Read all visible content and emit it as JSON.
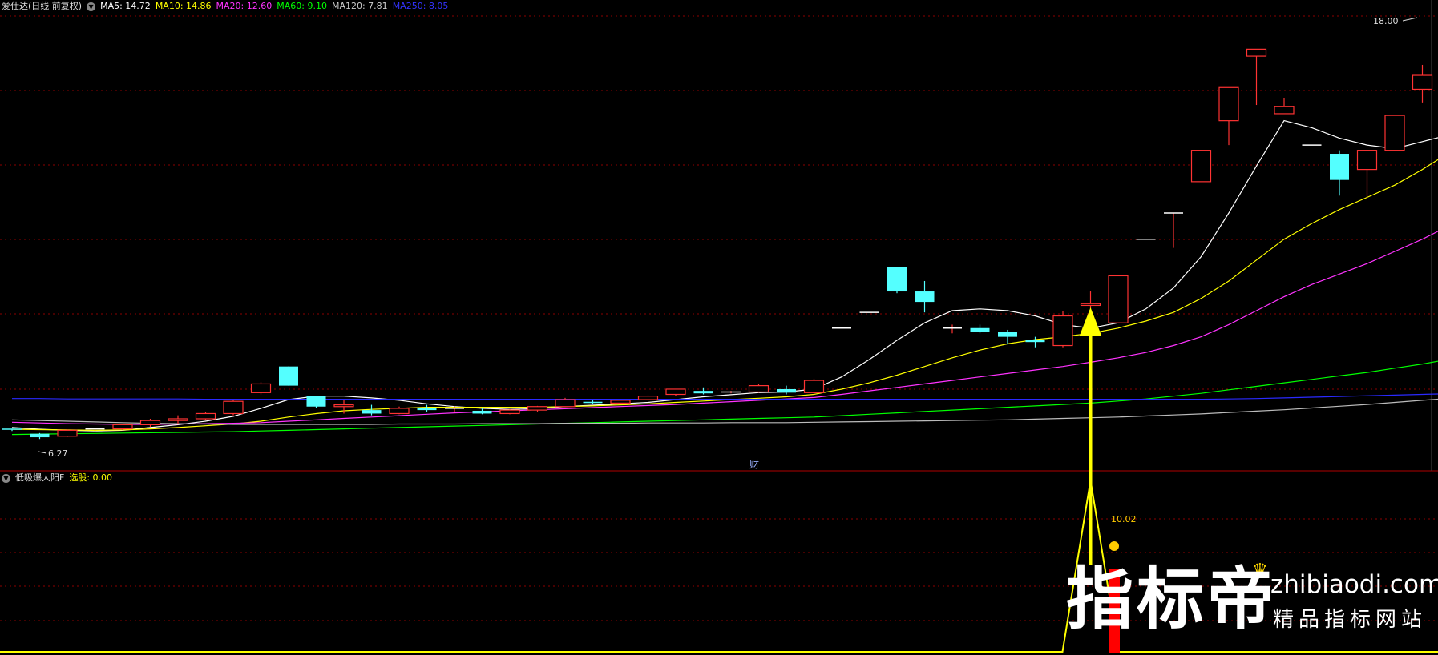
{
  "main_header": {
    "title": "爱仕达(日线 前复权)",
    "ma": [
      {
        "label": "MA5: 14.72",
        "color": "#ffffff"
      },
      {
        "label": "MA10: 14.86",
        "color": "#ffff00"
      },
      {
        "label": "MA20: 12.60",
        "color": "#ff33ff"
      },
      {
        "label": "MA60: 9.10",
        "color": "#00ff00"
      },
      {
        "label": "MA120: 7.81",
        "color": "#cccccc"
      },
      {
        "label": "MA250: 8.05",
        "color": "#2222ff"
      }
    ]
  },
  "sub_header": {
    "title": "低吸爆大阳F",
    "value_label": "选股: 0.00"
  },
  "annotations": {
    "high_label": "18.00",
    "low_label": "6.27",
    "cai_label": "财",
    "signal_value": "10.02",
    "signal_icon": "smiley-icon"
  },
  "watermark": {
    "cn": "指标帝",
    "url": "zhibiaodi.com",
    "sub": "精品指标网站"
  },
  "colors": {
    "up": "#ff3333",
    "down": "#54ffff",
    "grid": "#8b0000",
    "arrow": "#ffff00",
    "signal_bar": "#ff0000"
  },
  "chart_data": {
    "type": "candlestick",
    "ylim": [
      6.0,
      18.4
    ],
    "ohlc": [
      [
        6.55,
        6.55,
        6.5,
        6.52
      ],
      [
        6.42,
        6.44,
        6.27,
        6.32
      ],
      [
        6.35,
        6.55,
        6.33,
        6.52
      ],
      [
        6.52,
        6.58,
        6.48,
        6.56
      ],
      [
        6.56,
        6.7,
        6.52,
        6.68
      ],
      [
        6.68,
        6.85,
        6.62,
        6.8
      ],
      [
        6.8,
        6.95,
        6.7,
        6.85
      ],
      [
        6.85,
        7.05,
        6.8,
        7.0
      ],
      [
        7.0,
        7.4,
        6.95,
        7.35
      ],
      [
        7.6,
        7.9,
        7.55,
        7.85
      ],
      [
        8.35,
        8.35,
        7.8,
        7.8
      ],
      [
        7.5,
        7.5,
        7.15,
        7.2
      ],
      [
        7.2,
        7.4,
        7.0,
        7.25
      ],
      [
        7.1,
        7.25,
        6.95,
        7.0
      ],
      [
        7.0,
        7.2,
        6.98,
        7.15
      ],
      [
        7.15,
        7.25,
        7.05,
        7.1
      ],
      [
        7.12,
        7.2,
        7.05,
        7.15
      ],
      [
        7.08,
        7.15,
        6.98,
        7.0
      ],
      [
        7.0,
        7.12,
        6.98,
        7.1
      ],
      [
        7.1,
        7.22,
        7.05,
        7.2
      ],
      [
        7.2,
        7.45,
        7.18,
        7.4
      ],
      [
        7.32,
        7.38,
        7.28,
        7.3
      ],
      [
        7.3,
        7.4,
        7.28,
        7.38
      ],
      [
        7.4,
        7.52,
        7.38,
        7.5
      ],
      [
        7.55,
        7.7,
        7.5,
        7.7
      ],
      [
        7.65,
        7.75,
        7.55,
        7.58
      ],
      [
        7.6,
        7.65,
        7.58,
        7.62
      ],
      [
        7.62,
        7.85,
        7.6,
        7.8
      ],
      [
        7.7,
        7.8,
        7.55,
        7.6
      ],
      [
        7.6,
        8.0,
        7.55,
        7.95
      ],
      [
        9.45,
        9.45,
        9.45,
        9.45
      ],
      [
        9.9,
        9.9,
        9.9,
        9.9
      ],
      [
        11.2,
        11.2,
        10.45,
        10.5
      ],
      [
        10.5,
        10.8,
        9.9,
        10.2
      ],
      [
        9.45,
        9.55,
        9.3,
        9.45
      ],
      [
        9.45,
        9.55,
        9.3,
        9.35
      ],
      [
        9.35,
        9.4,
        9.0,
        9.2
      ],
      [
        9.1,
        9.2,
        8.9,
        9.05
      ],
      [
        8.95,
        9.95,
        8.9,
        9.8
      ],
      [
        10.1,
        10.5,
        10.0,
        10.15
      ],
      [
        9.6,
        10.95,
        9.6,
        10.95
      ],
      [
        12.0,
        12.0,
        12.0,
        12.0
      ],
      [
        12.75,
        12.75,
        11.75,
        12.75
      ],
      [
        13.65,
        14.55,
        13.65,
        14.55
      ],
      [
        15.4,
        16.35,
        14.7,
        16.35
      ],
      [
        17.25,
        17.45,
        15.85,
        17.45
      ],
      [
        15.6,
        16.05,
        15.6,
        15.8
      ],
      [
        14.7,
        14.7,
        14.7,
        14.7
      ],
      [
        14.45,
        14.55,
        13.25,
        13.7
      ],
      [
        14.0,
        14.55,
        13.2,
        14.55
      ],
      [
        14.55,
        15.55,
        14.55,
        15.55
      ],
      [
        16.3,
        17.0,
        15.9,
        16.7
      ],
      [
        16.1,
        18.0,
        15.0,
        16.2
      ]
    ],
    "series": [
      {
        "name": "MA5",
        "color": "#ffffff",
        "values": [
          6.6,
          6.55,
          6.52,
          6.5,
          6.52,
          6.6,
          6.68,
          6.78,
          6.92,
          7.15,
          7.4,
          7.5,
          7.5,
          7.45,
          7.38,
          7.28,
          7.2,
          7.15,
          7.12,
          7.14,
          7.2,
          7.24,
          7.28,
          7.32,
          7.4,
          7.48,
          7.54,
          7.6,
          7.62,
          7.7,
          8.05,
          8.55,
          9.1,
          9.6,
          9.95,
          10.0,
          9.95,
          9.8,
          9.55,
          9.45,
          9.6,
          10.0,
          10.6,
          11.5,
          12.75,
          14.1,
          15.4,
          15.2,
          14.9,
          14.7,
          14.6,
          14.8,
          15.0
        ]
      },
      {
        "name": "MA10",
        "color": "#ffff00",
        "values": [
          6.55,
          6.54,
          6.53,
          6.52,
          6.53,
          6.56,
          6.6,
          6.65,
          6.7,
          6.78,
          6.9,
          7.0,
          7.08,
          7.12,
          7.15,
          7.18,
          7.18,
          7.18,
          7.18,
          7.18,
          7.2,
          7.22,
          7.25,
          7.28,
          7.32,
          7.36,
          7.4,
          7.44,
          7.48,
          7.55,
          7.7,
          7.88,
          8.1,
          8.35,
          8.6,
          8.82,
          9.0,
          9.12,
          9.2,
          9.3,
          9.45,
          9.65,
          9.9,
          10.3,
          10.8,
          11.4,
          12.0,
          12.45,
          12.85,
          13.2,
          13.55,
          14.0,
          14.5
        ]
      },
      {
        "name": "MA20",
        "color": "#ff33ff",
        "values": [
          6.75,
          6.73,
          6.71,
          6.7,
          6.69,
          6.69,
          6.7,
          6.71,
          6.72,
          6.74,
          6.78,
          6.82,
          6.86,
          6.9,
          6.94,
          6.98,
          7.02,
          7.05,
          7.08,
          7.11,
          7.14,
          7.17,
          7.2,
          7.23,
          7.26,
          7.3,
          7.34,
          7.38,
          7.42,
          7.46,
          7.55,
          7.65,
          7.75,
          7.85,
          7.95,
          8.05,
          8.15,
          8.25,
          8.35,
          8.47,
          8.6,
          8.75,
          8.95,
          9.2,
          9.55,
          9.95,
          10.35,
          10.7,
          11.0,
          11.3,
          11.65,
          12.0,
          12.4
        ]
      },
      {
        "name": "MA60",
        "color": "#00ff00",
        "values": [
          6.4,
          6.41,
          6.42,
          6.43,
          6.44,
          6.45,
          6.46,
          6.47,
          6.48,
          6.5,
          6.52,
          6.54,
          6.56,
          6.58,
          6.6,
          6.62,
          6.64,
          6.66,
          6.68,
          6.7,
          6.72,
          6.74,
          6.76,
          6.78,
          6.8,
          6.82,
          6.84,
          6.86,
          6.88,
          6.9,
          6.94,
          6.98,
          7.02,
          7.06,
          7.1,
          7.14,
          7.18,
          7.22,
          7.26,
          7.3,
          7.36,
          7.42,
          7.5,
          7.58,
          7.68,
          7.78,
          7.88,
          7.98,
          8.08,
          8.18,
          8.3,
          8.42,
          8.56
        ]
      },
      {
        "name": "MA120",
        "color": "#bbbbbb",
        "values": [
          6.82,
          6.8,
          6.78,
          6.76,
          6.74,
          6.72,
          6.71,
          6.7,
          6.69,
          6.69,
          6.69,
          6.69,
          6.69,
          6.69,
          6.7,
          6.7,
          6.7,
          6.71,
          6.71,
          6.71,
          6.72,
          6.72,
          6.72,
          6.73,
          6.73,
          6.73,
          6.74,
          6.74,
          6.74,
          6.75,
          6.76,
          6.77,
          6.78,
          6.79,
          6.8,
          6.81,
          6.82,
          6.84,
          6.86,
          6.88,
          6.9,
          6.93,
          6.96,
          6.99,
          7.03,
          7.07,
          7.11,
          7.16,
          7.21,
          7.26,
          7.32,
          7.38,
          7.44
        ]
      },
      {
        "name": "MA250",
        "color": "#2a2aff",
        "values": [
          7.43,
          7.43,
          7.42,
          7.42,
          7.42,
          7.42,
          7.42,
          7.41,
          7.41,
          7.41,
          7.41,
          7.41,
          7.41,
          7.41,
          7.41,
          7.41,
          7.41,
          7.41,
          7.41,
          7.41,
          7.41,
          7.41,
          7.41,
          7.41,
          7.41,
          7.41,
          7.41,
          7.41,
          7.41,
          7.41,
          7.41,
          7.41,
          7.41,
          7.41,
          7.41,
          7.41,
          7.41,
          7.41,
          7.41,
          7.41,
          7.41,
          7.41,
          7.41,
          7.41,
          7.42,
          7.43,
          7.45,
          7.47,
          7.49,
          7.51,
          7.53,
          7.55,
          7.57
        ]
      }
    ],
    "signal": {
      "index": 40,
      "value": 10.02
    }
  }
}
